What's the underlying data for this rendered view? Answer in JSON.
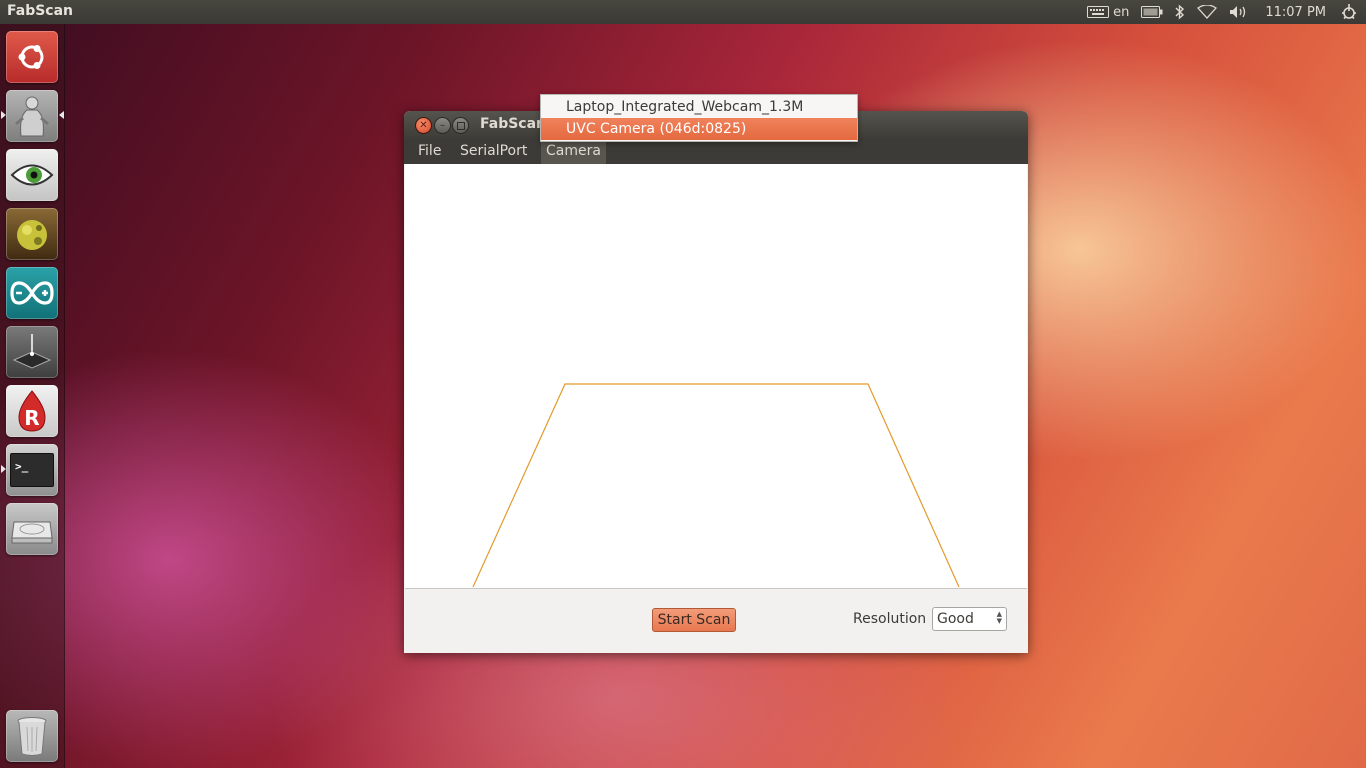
{
  "top_panel": {
    "title": "FabScan",
    "keyboard_layout": "en",
    "clock": "11:07 PM",
    "icons": [
      "keyboard-icon",
      "battery-icon",
      "bluetooth-icon",
      "wifi-icon",
      "volume-icon",
      "gear-icon"
    ]
  },
  "launcher": {
    "items": [
      {
        "name": "dash-home",
        "icon": "ubuntu-logo-icon",
        "color": "#c93b3b"
      },
      {
        "name": "fabscan-app",
        "icon": "statue-icon",
        "color": "#8f8f8f"
      },
      {
        "name": "eye-app",
        "icon": "eye-icon",
        "color": "#d9d9d9"
      },
      {
        "name": "sphere-app",
        "icon": "green-sphere-icon",
        "color": "#6b4a20"
      },
      {
        "name": "arduino-app",
        "icon": "arduino-icon",
        "color": "#19868c"
      },
      {
        "name": "laser-app",
        "icon": "laser-device-icon",
        "color": "#666666"
      },
      {
        "name": "r-app",
        "icon": "r-drop-icon",
        "color": "#d8d8d8"
      },
      {
        "name": "terminal-app",
        "icon": "terminal-icon",
        "color": "#a5a5a5"
      },
      {
        "name": "disk-app",
        "icon": "hard-disk-icon",
        "color": "#9a9a9a"
      },
      {
        "name": "trash",
        "icon": "trash-icon",
        "color": "#9a9a9a"
      }
    ],
    "terminal_glyph": ">_"
  },
  "window": {
    "title": "FabScan",
    "menu": {
      "file": "File",
      "serialport": "SerialPort",
      "camera": "Camera"
    },
    "camera_menu": {
      "items": [
        "Laptop_Integrated_Webcam_1.3M",
        "UVC Camera (046d:0825)"
      ],
      "highlighted_index": 1
    },
    "bottom": {
      "start_scan": "Start Scan",
      "resolution_label": "Resolution",
      "resolution_value": "Good"
    },
    "accent_color": "#e8784f",
    "outline_color": "#e39a2a"
  }
}
